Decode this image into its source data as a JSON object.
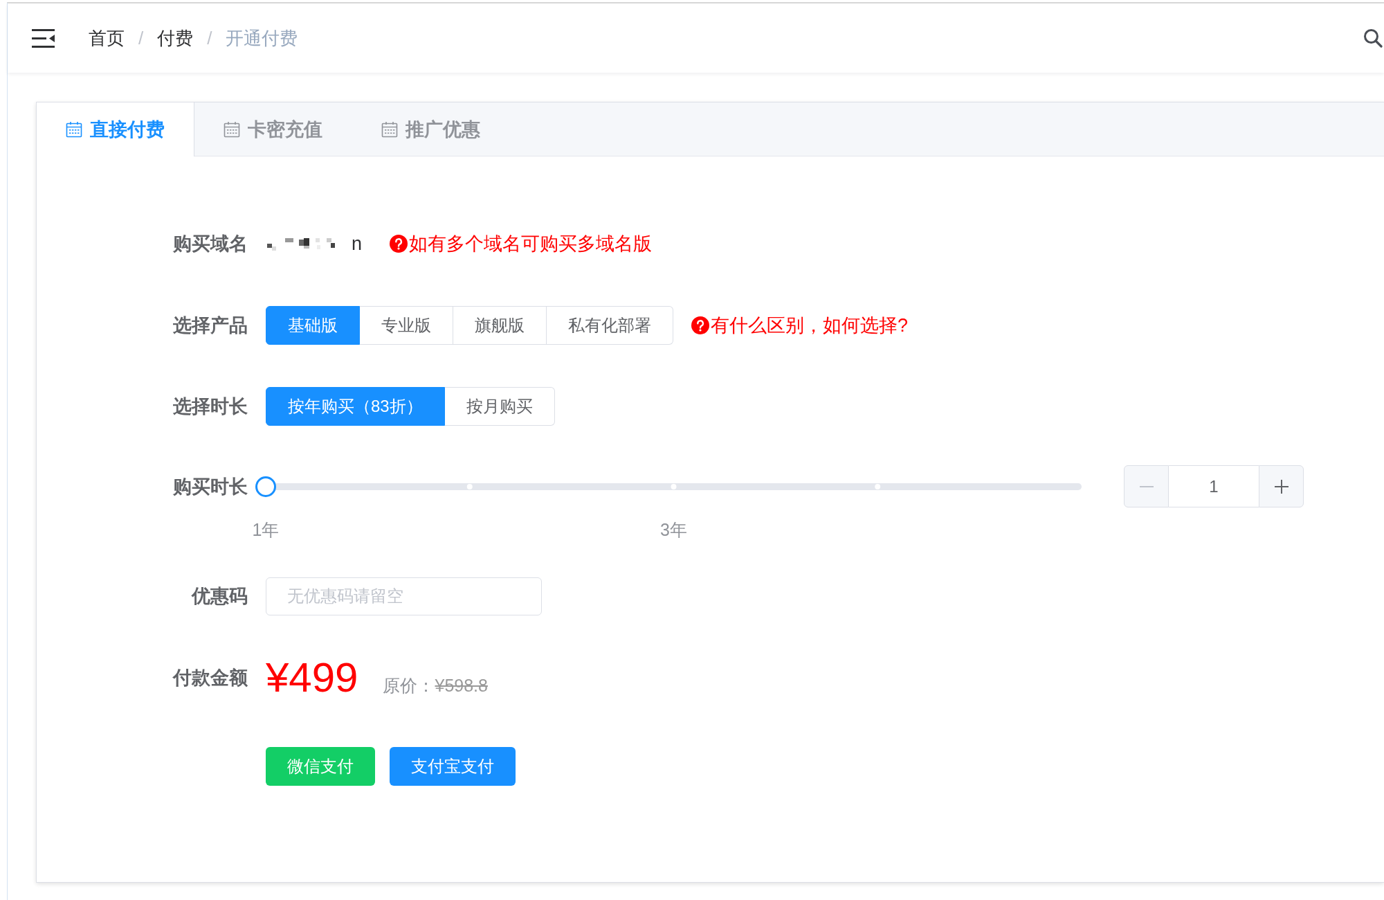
{
  "header": {
    "breadcrumb": [
      {
        "label": "首页",
        "current": false,
        "separator": "/"
      },
      {
        "label": "付费",
        "current": false,
        "separator": "/"
      },
      {
        "label": "开通付费",
        "current": true
      }
    ]
  },
  "tabs": [
    {
      "label": "直接付费",
      "selected": true
    },
    {
      "label": "卡密充值",
      "selected": false
    },
    {
      "label": "推广优惠",
      "selected": false
    }
  ],
  "form": {
    "domain": {
      "label": "购买域名",
      "redacted": true,
      "value": "n",
      "hint": "如有多个域名可购买多域名版"
    },
    "product": {
      "label": "选择产品",
      "options": [
        {
          "label": "基础版",
          "selected": true
        },
        {
          "label": "专业版",
          "selected": false
        },
        {
          "label": "旗舰版",
          "selected": false
        },
        {
          "label": "私有化部署",
          "selected": false
        }
      ],
      "hint": "有什么区别，如何选择?"
    },
    "billing": {
      "label": "选择时长",
      "options": [
        {
          "label": "按年购买（83折）",
          "selected": true
        },
        {
          "label": "按月购买",
          "selected": false
        }
      ]
    },
    "duration": {
      "label": "购买时长",
      "slider": {
        "level": 0,
        "marks": [
          "1年",
          "3年"
        ]
      },
      "stepper": {
        "value": "1",
        "decrease_disabled": true
      }
    },
    "coupon": {
      "label": "优惠码",
      "placeholder": "无优惠码请留空"
    },
    "payment": {
      "label": "付款金额",
      "price": "¥499",
      "original_label": "原价：",
      "original_price": "¥598.8"
    },
    "buttons": [
      {
        "label": "微信支付",
        "kind": "wechat"
      },
      {
        "label": "支付宝支付",
        "kind": "alipay"
      }
    ]
  }
}
